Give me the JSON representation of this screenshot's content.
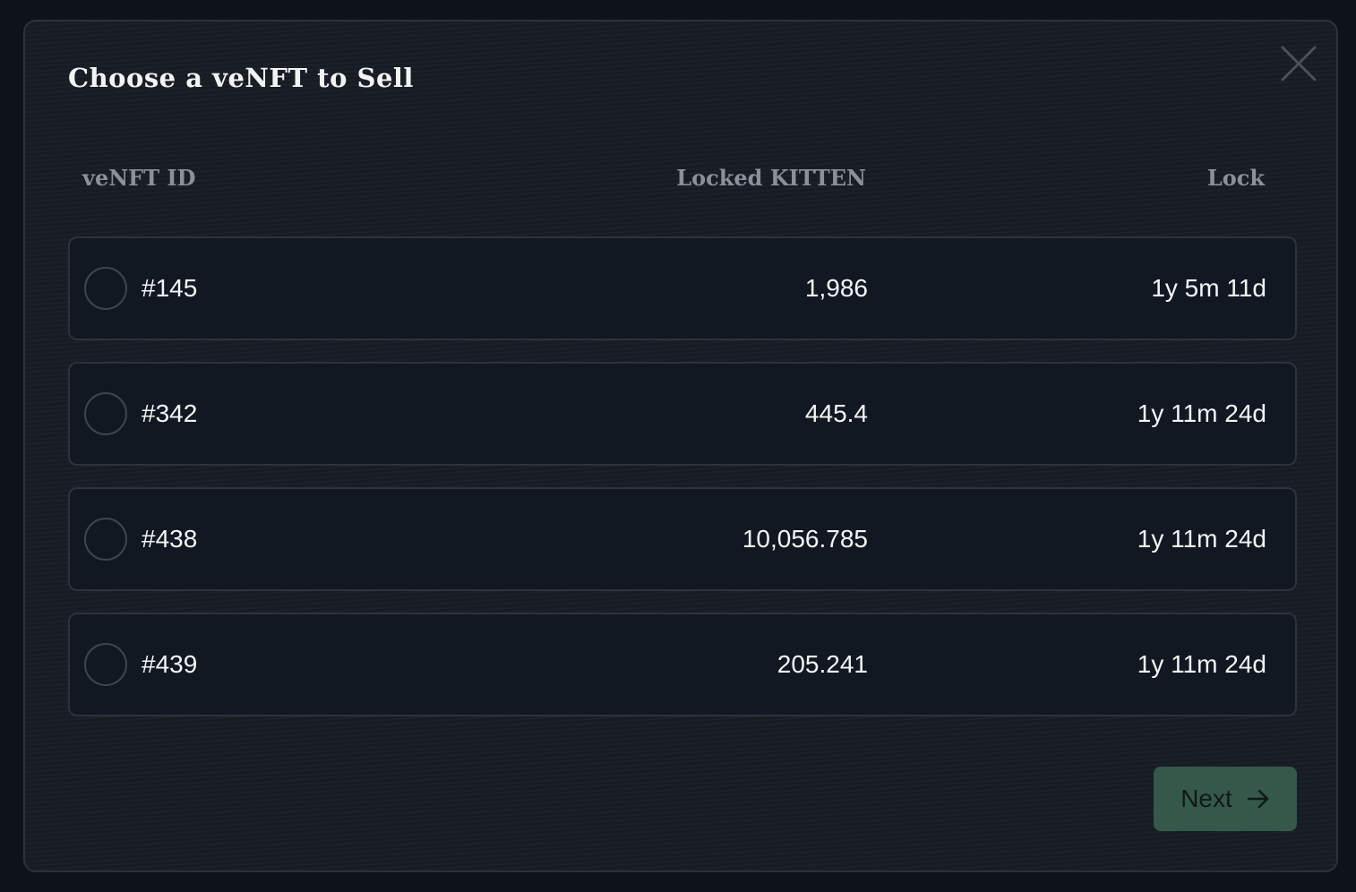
{
  "modal": {
    "title": "Choose a veNFT to Sell",
    "close_icon": "close-icon"
  },
  "table": {
    "headers": {
      "id": "veNFT ID",
      "locked": "Locked KITTEN",
      "lock": "Lock"
    },
    "rows": [
      {
        "id": "#145",
        "locked": "1,986",
        "lock": "1y 5m 11d",
        "selected": false
      },
      {
        "id": "#342",
        "locked": "445.4",
        "lock": "1y 11m 24d",
        "selected": false
      },
      {
        "id": "#438",
        "locked": "10,056.785",
        "lock": "1y 11m 24d",
        "selected": false
      },
      {
        "id": "#439",
        "locked": "205.241",
        "lock": "1y 11m 24d",
        "selected": false
      }
    ]
  },
  "footer": {
    "next_label": "Next",
    "next_icon": "arrow-right-icon"
  },
  "colors": {
    "background": "#0e131b",
    "panel": "#181d25",
    "row": "#121821",
    "border": "#2d323b",
    "accent_button": "#35584a",
    "muted_text": "#8b909a",
    "text": "#f4f5f7"
  }
}
